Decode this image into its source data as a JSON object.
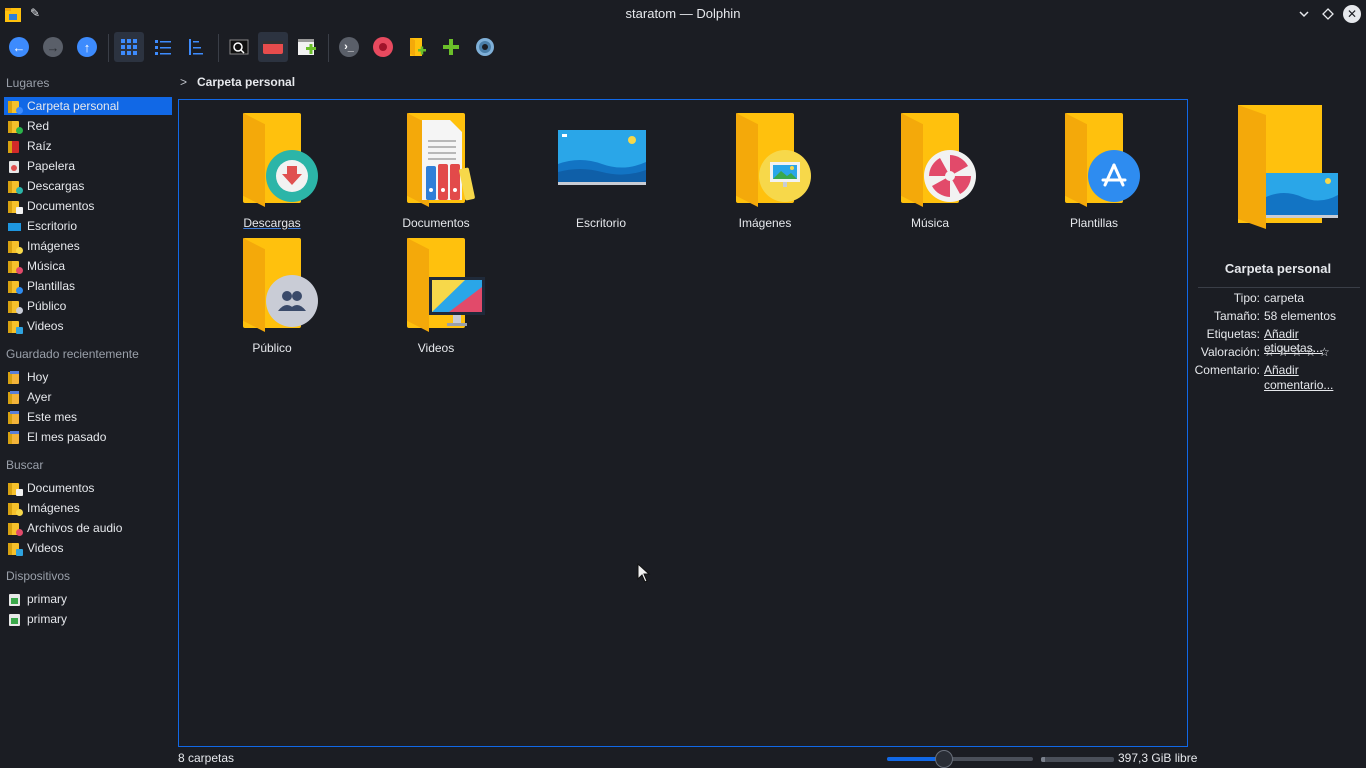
{
  "window": {
    "title": "staratom — Dolphin"
  },
  "toolbar": {
    "buttons": [
      "back-icon",
      "forward-icon",
      "up-icon",
      "icons-view-icon",
      "compact-view-icon",
      "details-view-icon",
      "preview-icon",
      "split-icon",
      "new-tab-icon",
      "terminal-icon",
      "record-icon",
      "new-folder-icon",
      "add-icon",
      "settings-icon"
    ]
  },
  "sidebar": {
    "places_header": "Lugares",
    "places": [
      {
        "label": "Carpeta personal",
        "icon": "home-folder-icon",
        "selected": true
      },
      {
        "label": "Red",
        "icon": "network-icon"
      },
      {
        "label": "Raíz",
        "icon": "root-icon"
      },
      {
        "label": "Papelera",
        "icon": "trash-icon"
      },
      {
        "label": "Descargas",
        "icon": "downloads-folder-icon"
      },
      {
        "label": "Documentos",
        "icon": "documents-folder-icon"
      },
      {
        "label": "Escritorio",
        "icon": "desktop-folder-icon"
      },
      {
        "label": "Imágenes",
        "icon": "pictures-folder-icon"
      },
      {
        "label": "Música",
        "icon": "music-folder-icon"
      },
      {
        "label": "Plantillas",
        "icon": "templates-folder-icon"
      },
      {
        "label": "Público",
        "icon": "public-folder-icon"
      },
      {
        "label": "Videos",
        "icon": "videos-folder-icon"
      }
    ],
    "recent_header": "Guardado recientemente",
    "recent": [
      {
        "label": "Hoy",
        "icon": "calendar-today-icon"
      },
      {
        "label": "Ayer",
        "icon": "calendar-yesterday-icon"
      },
      {
        "label": "Este mes",
        "icon": "calendar-month-icon"
      },
      {
        "label": "El mes pasado",
        "icon": "calendar-last-month-icon"
      }
    ],
    "search_header": "Buscar",
    "search": [
      {
        "label": "Documentos",
        "icon": "documents-search-icon"
      },
      {
        "label": "Imágenes",
        "icon": "images-search-icon"
      },
      {
        "label": "Archivos de audio",
        "icon": "audio-search-icon"
      },
      {
        "label": "Videos",
        "icon": "videos-search-icon"
      }
    ],
    "devices_header": "Dispositivos",
    "devices": [
      {
        "label": "primary",
        "icon": "drive-icon"
      },
      {
        "label": "primary",
        "icon": "drive-icon"
      }
    ]
  },
  "breadcrumb": {
    "current": "Carpeta personal"
  },
  "folders": [
    {
      "name": "Descargas",
      "badge": "download"
    },
    {
      "name": "Documentos",
      "badge": "documents"
    },
    {
      "name": "Escritorio",
      "badge": "desktop"
    },
    {
      "name": "Imágenes",
      "badge": "pictures"
    },
    {
      "name": "Música",
      "badge": "music"
    },
    {
      "name": "Plantillas",
      "badge": "templates"
    },
    {
      "name": "Público",
      "badge": "public"
    },
    {
      "name": "Videos",
      "badge": "videos"
    }
  ],
  "info": {
    "title": "Carpeta personal",
    "tipo_label": "Tipo:",
    "tipo_value": "carpeta",
    "tamano_label": "Tamaño:",
    "tamano_value": "58 elementos",
    "etiquetas_label": "Etiquetas:",
    "etiquetas_value": "Añadir etiquetas...",
    "valoracion_label": "Valoración:",
    "valoracion_value": "☆☆☆☆☆",
    "comentario_label": "Comentario:",
    "comentario_value": "Añadir comentario..."
  },
  "status": {
    "count": "8 carpetas",
    "free": "397,3 GiB libre",
    "zoom_level": 0.39,
    "used_fraction": 0.05
  },
  "colors": {
    "accent": "#1168e6",
    "folder": "#ffc10d",
    "background": "#1b1d23"
  }
}
